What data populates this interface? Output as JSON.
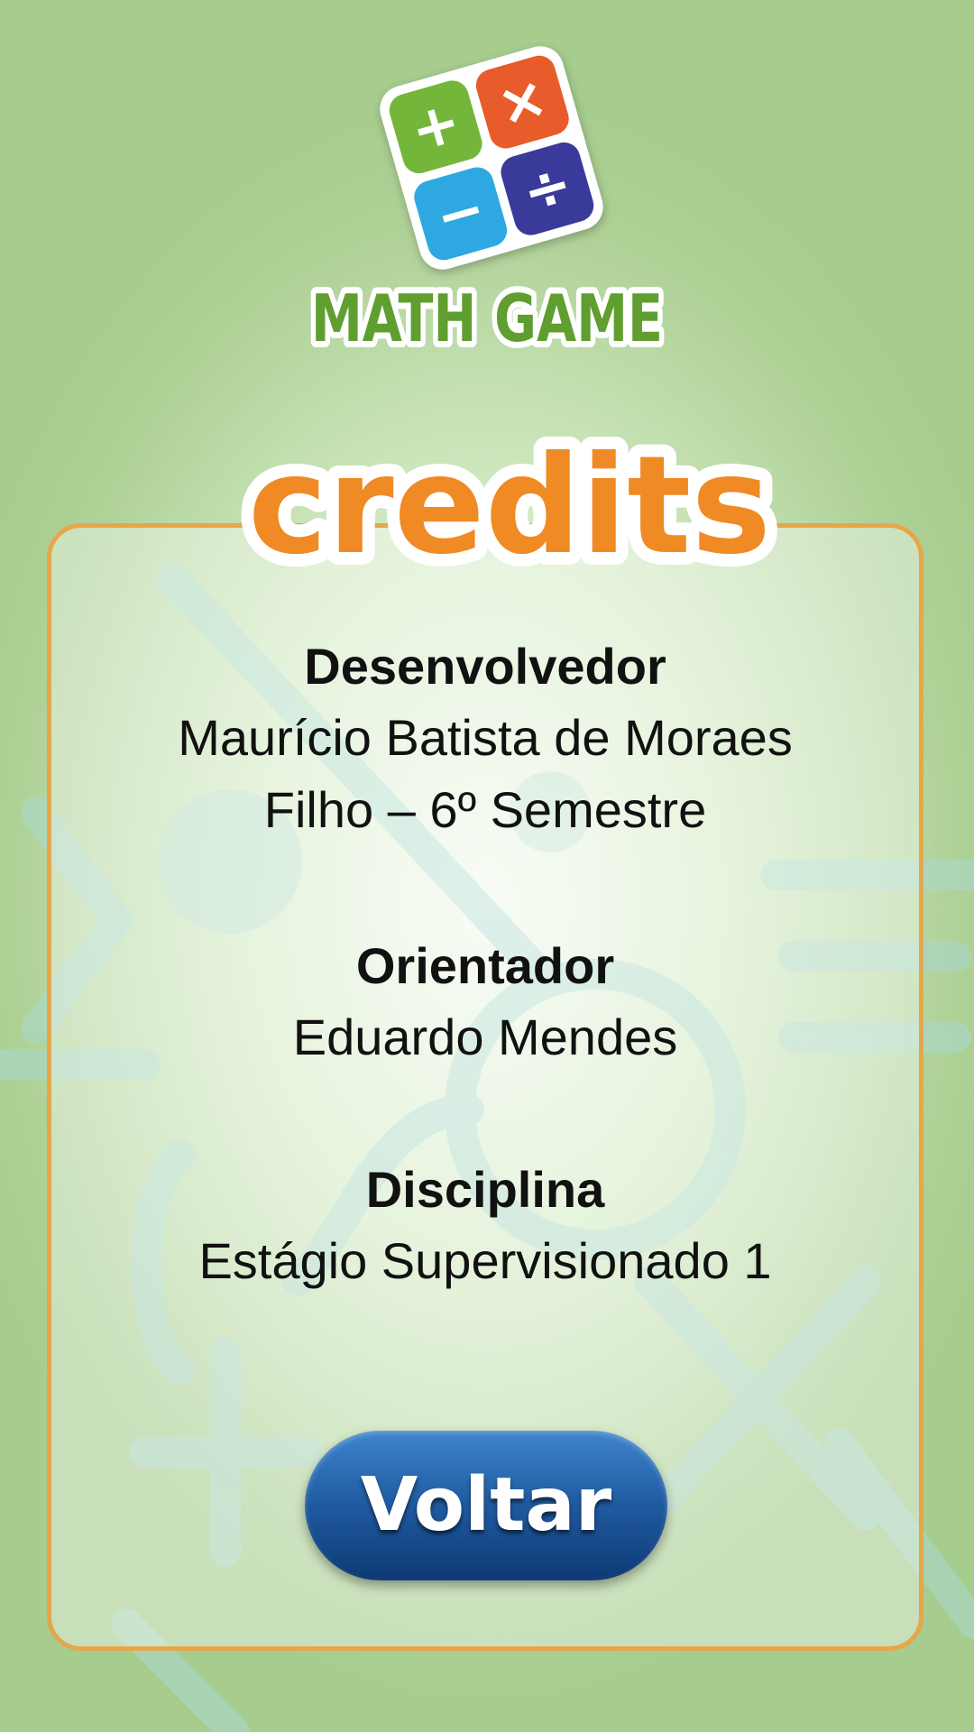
{
  "logo": {
    "tile_plus": "+",
    "tile_times": "×",
    "tile_minus": "−",
    "tile_divide": "÷",
    "text": "MATH GAME"
  },
  "credits": {
    "title": "credits",
    "developer_label": "Desenvolvedor",
    "developer_name": "Maurício Batista de Moraes Filho – 6º Semestre",
    "advisor_label": "Orientador",
    "advisor_name": "Eduardo Mendes",
    "course_label": "Disciplina",
    "course_name": "Estágio Supervisionado 1"
  },
  "buttons": {
    "back_label": "Voltar"
  },
  "colors": {
    "background": "#aed196",
    "title_orange": "#f08a24",
    "panel_border": "#e6a64a",
    "button_blue": "#1f5aa0",
    "logo_green": "#5f9e2f"
  }
}
